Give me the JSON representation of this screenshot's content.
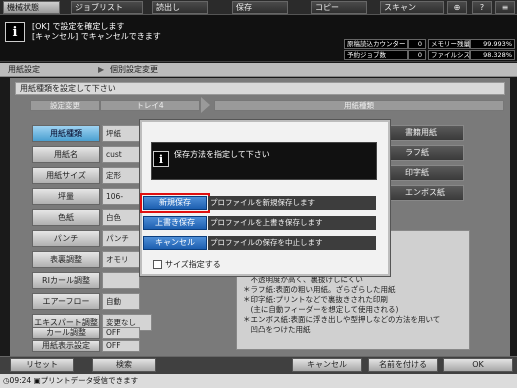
{
  "top_tabs": [
    {
      "label": "機械状態",
      "active": true
    },
    {
      "label": "ジョブリスト",
      "active": false
    },
    {
      "label": "読出し",
      "active": false
    },
    {
      "label": "保存",
      "active": false
    },
    {
      "label": "コピー",
      "active": false
    },
    {
      "label": "スキャン",
      "active": false
    }
  ],
  "message": {
    "line1": "[OK] で設定を確定します",
    "line2": "[キャンセル] でキャンセルできます"
  },
  "status": {
    "counter_label": "原稿読込カウンター",
    "counter_value": "0",
    "memory_label": "メモリー残量",
    "memory_value": "99.993%",
    "job_label": "予約ジョブ数",
    "job_value": "0",
    "fs_label": "ファイルシステム残量",
    "fs_value": "98.328%"
  },
  "breadcrumb": {
    "item1": "用紙設定",
    "item2": "個別設定変更"
  },
  "main": {
    "header": "用紙種類を設定して下さい",
    "left_col_header": "設定変更",
    "left_col_sub": "トレイ4",
    "right_col_header": "用紙種類",
    "settings": [
      {
        "label": "用紙種類",
        "value": "坪紙",
        "selected": true
      },
      {
        "label": "用紙名",
        "value": "cust"
      },
      {
        "label": "用紙サイズ",
        "value": "定形"
      },
      {
        "label": "坪量",
        "value": "106-"
      },
      {
        "label": "色紙",
        "value": "白色"
      },
      {
        "label": "パンチ",
        "value": "パンチ"
      },
      {
        "label": "表裏調整",
        "value": "オモリ"
      },
      {
        "label": "RIカール調整",
        "value": ""
      },
      {
        "label": "エアーフロー",
        "value": "自動"
      },
      {
        "label": "エキスパート調整",
        "value": "変更なし"
      },
      {
        "label": "カール調整",
        "value": "OFF"
      },
      {
        "label": "用紙表示設定",
        "value": "OFF"
      }
    ],
    "paper_types": [
      "書籍用紙",
      "ラフ紙",
      "印字紙",
      "エンボス紙"
    ],
    "info_text": "いて下さい)\nな用紙\n\n＊書籍用紙:書籍の本文に用いられる用紙\n　不透明度が高く、裏抜けしにくい\n＊ラフ紙:表面の粗い用紙。ざらざらした用紙\n＊印字紙:プリントなどで裏抜きされた印刷\n　(主に自動フィーダーを想定して使用される)\n＊エンボス紙:表面に浮き出しや型押しなどの方法を用いて\n　凹凸をつけた用紙"
  },
  "dialog": {
    "title": "保存方法を指定して下さい",
    "buttons": [
      {
        "label": "新規保存",
        "desc": "プロファイルを新規保存します"
      },
      {
        "label": "上書き保存",
        "desc": "プロファイルを上書き保存します"
      },
      {
        "label": "キャンセル",
        "desc": "プロファイルの保存を中止します"
      }
    ],
    "checkbox_label": "サイズ指定する"
  },
  "bottom": {
    "reset": "リセット",
    "search": "検索",
    "cancel": "キャンセル",
    "save_as": "名前を付ける",
    "ok": "OK"
  },
  "statusbar": {
    "time": "09:24",
    "text": "プリントデータ受信できます"
  }
}
